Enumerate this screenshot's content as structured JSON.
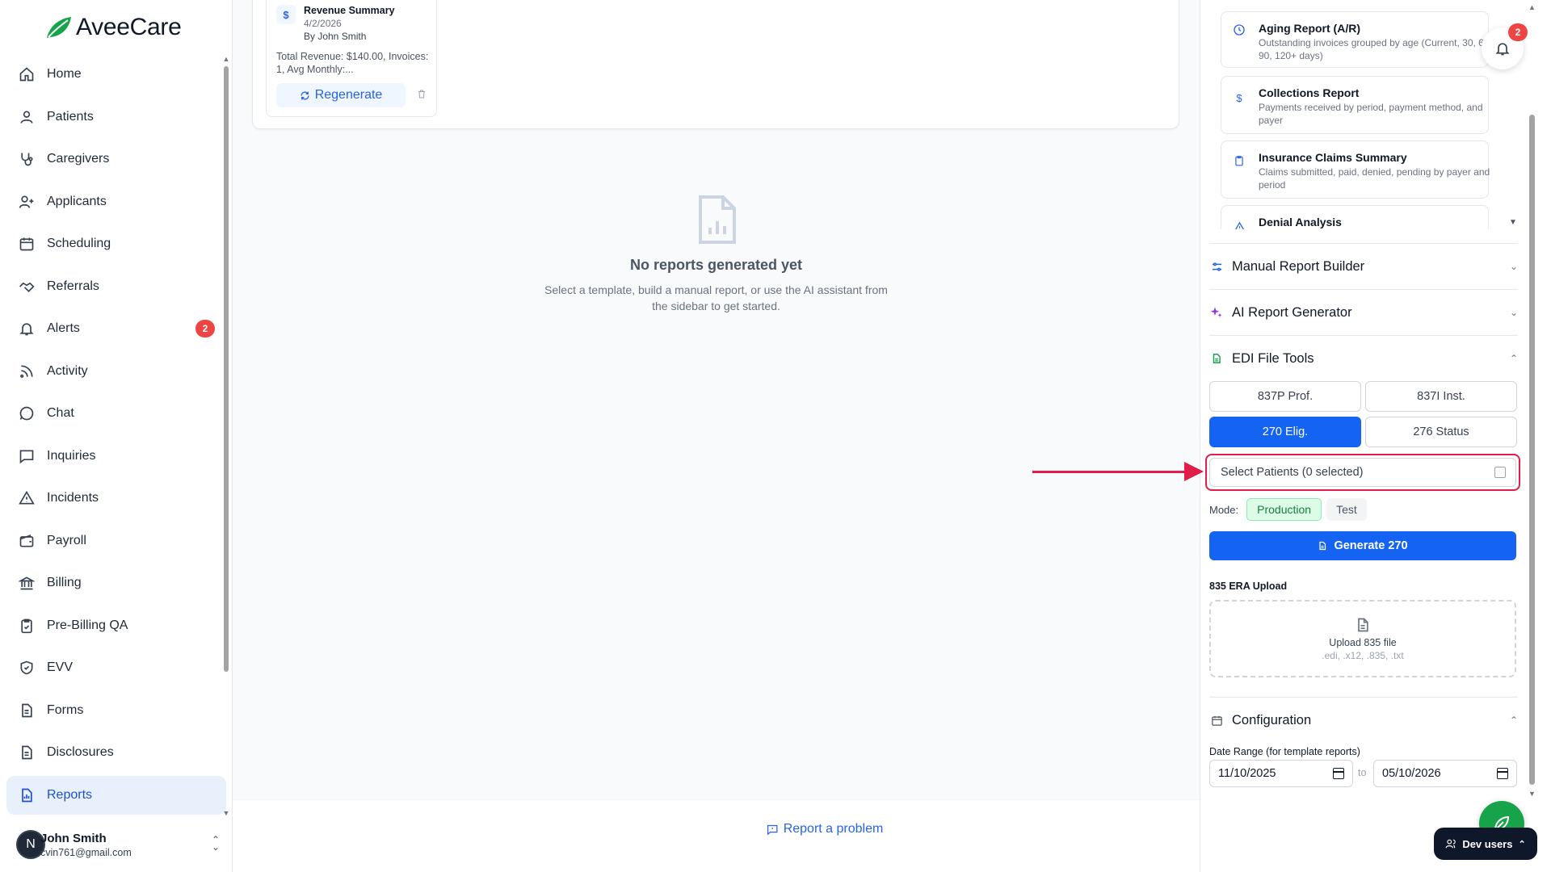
{
  "brand": {
    "name": "AveeCare",
    "accent": "#16a34a"
  },
  "sidebar": {
    "items": [
      {
        "label": "Home",
        "icon": "home-icon"
      },
      {
        "label": "Patients",
        "icon": "user-icon"
      },
      {
        "label": "Caregivers",
        "icon": "stethoscope-icon"
      },
      {
        "label": "Applicants",
        "icon": "user-plus-icon"
      },
      {
        "label": "Scheduling",
        "icon": "calendar-icon"
      },
      {
        "label": "Referrals",
        "icon": "handshake-icon"
      },
      {
        "label": "Alerts",
        "icon": "bell-icon",
        "badge": "2"
      },
      {
        "label": "Activity",
        "icon": "rss-icon"
      },
      {
        "label": "Chat",
        "icon": "chat-bubble-icon"
      },
      {
        "label": "Inquiries",
        "icon": "message-square-icon"
      },
      {
        "label": "Incidents",
        "icon": "warning-triangle-icon"
      },
      {
        "label": "Payroll",
        "icon": "wallet-icon"
      },
      {
        "label": "Billing",
        "icon": "bank-icon"
      },
      {
        "label": "Pre-Billing QA",
        "icon": "clipboard-check-icon"
      },
      {
        "label": "EVV",
        "icon": "shield-check-icon"
      },
      {
        "label": "Forms",
        "icon": "file-text-icon"
      },
      {
        "label": "Disclosures",
        "icon": "file-text-icon"
      },
      {
        "label": "Reports",
        "icon": "bar-chart-file-icon",
        "active": true
      }
    ],
    "user": {
      "initial": "N",
      "name": "John Smith",
      "email": "cvin761@gmail.com"
    }
  },
  "main": {
    "report_tile": {
      "title": "Revenue Summary",
      "date": "4/2/2026",
      "author": "By John Smith",
      "summary": "Total Revenue: $140.00, Invoices: 1, Avg Monthly:...",
      "regenerate_label": "Regenerate"
    },
    "empty": {
      "title": "No reports generated yet",
      "description": "Select a template, build a manual report, or use the AI assistant from the sidebar to get started."
    },
    "report_problem_label": "Report a problem"
  },
  "right_panel": {
    "templates": [
      {
        "name": "Aging Report (A/R)",
        "description": "Outstanding invoices grouped by age (Current, 30, 60, 90, 120+ days)",
        "icon": "clock-icon"
      },
      {
        "name": "Collections Report",
        "description": "Payments received by period, payment method, and payer",
        "icon": "dollar-icon"
      },
      {
        "name": "Insurance Claims Summary",
        "description": "Claims submitted, paid, denied, pending by payer and period",
        "icon": "clipboard-icon"
      },
      {
        "name": "Denial Analysis",
        "description": "",
        "icon": "warning-icon"
      }
    ],
    "sections": {
      "manual": "Manual Report Builder",
      "ai": "AI Report Generator",
      "edi": "EDI File Tools",
      "config": "Configuration"
    },
    "edi": {
      "tabs": [
        {
          "label": "837P Prof.",
          "selected": false
        },
        {
          "label": "837I Inst.",
          "selected": false
        },
        {
          "label": "270 Elig.",
          "selected": true
        },
        {
          "label": "276 Status",
          "selected": false
        }
      ],
      "select_patients": "Select Patients (0 selected)",
      "mode_label": "Mode:",
      "mode_production": "Production",
      "mode_test": "Test",
      "generate_label": "Generate 270",
      "era_label": "835 ERA Upload",
      "upload_title": "Upload 835 file",
      "upload_hint": ".edi, .x12, .835, .txt"
    },
    "config": {
      "date_range_label": "Date Range (for template reports)",
      "from": "11/10/2025",
      "to_label": "to",
      "to": "05/10/2026"
    },
    "notifications_count": "2",
    "dev_users_label": "Dev users"
  },
  "colors": {
    "primary": "#1463f3",
    "danger": "#ef4444",
    "highlight": "#e11d48"
  }
}
